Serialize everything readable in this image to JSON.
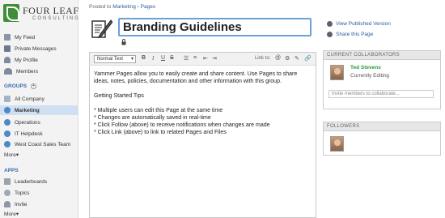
{
  "brand": {
    "title": "FOUR LEAF",
    "subtitle": "CONSULTING"
  },
  "sidebar": {
    "top_items": [
      {
        "label": "My Feed",
        "icon": "feed-icon"
      },
      {
        "label": "Private Messages",
        "icon": "message-icon"
      },
      {
        "label": "My Profile",
        "icon": "profile-icon"
      },
      {
        "label": "Members",
        "icon": "members-icon"
      }
    ],
    "groups_head": "GROUPS",
    "groups": [
      {
        "label": "All Company"
      },
      {
        "label": "Marketing",
        "active": true
      },
      {
        "label": "Operations"
      },
      {
        "label": "IT Helpdesk"
      },
      {
        "label": "West Coast Sales Team"
      }
    ],
    "groups_more": "More",
    "apps_head": "APPS",
    "apps": [
      {
        "label": "Leaderboards"
      },
      {
        "label": "Topics"
      },
      {
        "label": "Invite"
      }
    ],
    "apps_more": "More"
  },
  "breadcrumb": {
    "prefix": "Posted to",
    "group": "Marketing",
    "sep": "›",
    "section": "Pages"
  },
  "page": {
    "title": "Branding Guidelines"
  },
  "editor": {
    "format_select": "Normal Text",
    "toolbar": {
      "bold": "B",
      "italic": "I",
      "underline": "U",
      "strike": "S",
      "link_label": "Link to:"
    },
    "intro": "Yammer Pages allow you to easily create and share content. Use Pages to share ideas, notes, policies, documentation and other information with this group.",
    "tips_head": "Getting Started Tips",
    "tips": [
      "* Multiple users can edit this Page at the same time",
      "* Changes are automatically saved in real-time",
      "* Click Follow (above) to receive notifications when changes are made",
      "* Click Link (above) to link to related Pages and Files"
    ]
  },
  "right": {
    "view_published": "View Published Version",
    "share": "Share this Page",
    "collaborators_head": "CURRENT COLLABORATORS",
    "collaborator": {
      "name": "Ted Stevens",
      "status": "Currently Editing"
    },
    "invite_placeholder": "Invite members to collaborate...",
    "followers_head": "FOLLOWERS"
  },
  "colors": {
    "accent": "#2a5d9e",
    "active_nav": "#cfe0f3",
    "editing_green": "#2d9a3c",
    "title_border": "#6e9fd6"
  }
}
